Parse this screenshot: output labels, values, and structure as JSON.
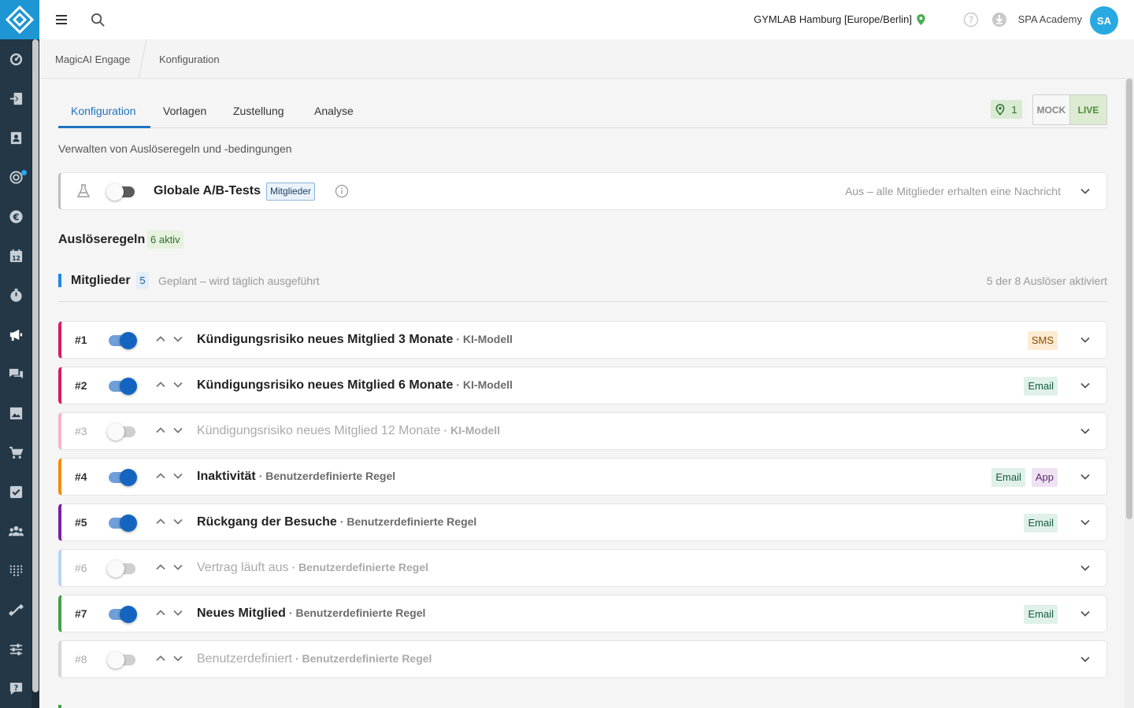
{
  "topbar": {
    "location": "GYMLAB Hamburg [Europe/Berlin]",
    "user_name": "SPA Academy",
    "avatar_initials": "SA"
  },
  "breadcrumbs": [
    "MagicAI Engage",
    "Konfiguration"
  ],
  "tabs": [
    {
      "label": "Konfiguration",
      "active": true
    },
    {
      "label": "Vorlagen",
      "active": false
    },
    {
      "label": "Zustellung",
      "active": false
    },
    {
      "label": "Analyse",
      "active": false
    }
  ],
  "location_count": "1",
  "mode": {
    "mock_label": "MOCK",
    "live_label": "LIVE",
    "selected": "LIVE"
  },
  "subtitle": "Verwalten von Auslöseregeln und -bedingungen",
  "ab_tests": {
    "title": "Globale A/B-Tests",
    "badge": "Mitglieder",
    "status": "Aus – alle Mitglieder erhalten eine Nachricht",
    "enabled": false
  },
  "rules_section": {
    "title": "Auslöseregeln",
    "badge": "6 aktiv"
  },
  "group": {
    "title": "Mitglieder",
    "count": "5",
    "subtitle": "Geplant – wird täglich ausgeführt",
    "summary": "5 der 8 Auslöser aktiviert"
  },
  "rules": [
    {
      "num": "#1",
      "title": "Kündigungsrisiko neues Mitglied 3 Monate",
      "kind": "· KI-Modell",
      "enabled": true,
      "color": "#d81b60",
      "channels": [
        "SMS"
      ]
    },
    {
      "num": "#2",
      "title": "Kündigungsrisiko neues Mitglied 6 Monate",
      "kind": "· KI-Modell",
      "enabled": true,
      "color": "#d81b60",
      "channels": [
        "Email"
      ]
    },
    {
      "num": "#3",
      "title": "Kündigungsrisiko neues Mitglied 12 Monate",
      "kind": "· KI-Modell",
      "enabled": false,
      "color": "#f4b6c8",
      "channels": []
    },
    {
      "num": "#4",
      "title": "Inaktivität",
      "kind": "· Benutzerdefinierte Regel",
      "enabled": true,
      "color": "#f58c00",
      "channels": [
        "Email",
        "App"
      ]
    },
    {
      "num": "#5",
      "title": "Rückgang der Besuche",
      "kind": "· Benutzerdefinierte Regel",
      "enabled": true,
      "color": "#7b1fa2",
      "channels": [
        "Email"
      ]
    },
    {
      "num": "#6",
      "title": "Vertrag läuft aus",
      "kind": "· Benutzerdefinierte Regel",
      "enabled": false,
      "color": "#b9d4f3",
      "channels": []
    },
    {
      "num": "#7",
      "title": "Neues Mitglied",
      "kind": "· Benutzerdefinierte Regel",
      "enabled": true,
      "color": "#43a047",
      "channels": [
        "Email"
      ]
    },
    {
      "num": "#8",
      "title": "Benutzerdefiniert",
      "kind": "· Benutzerdefinierte Regel",
      "enabled": false,
      "color": "#d6d6d6",
      "channels": []
    }
  ],
  "rail_icons": [
    "dashboard-icon",
    "checkin-icon",
    "contacts-icon",
    "marketing-target-icon",
    "euro-icon",
    "calendar-icon",
    "timer-icon",
    "megaphone-icon",
    "chat-icon",
    "image-icon",
    "cart-icon",
    "task-check-icon",
    "members-icon",
    "dots-grid-icon",
    "dumbbell-icon",
    "sliders-icon",
    "help-chat-icon"
  ]
}
